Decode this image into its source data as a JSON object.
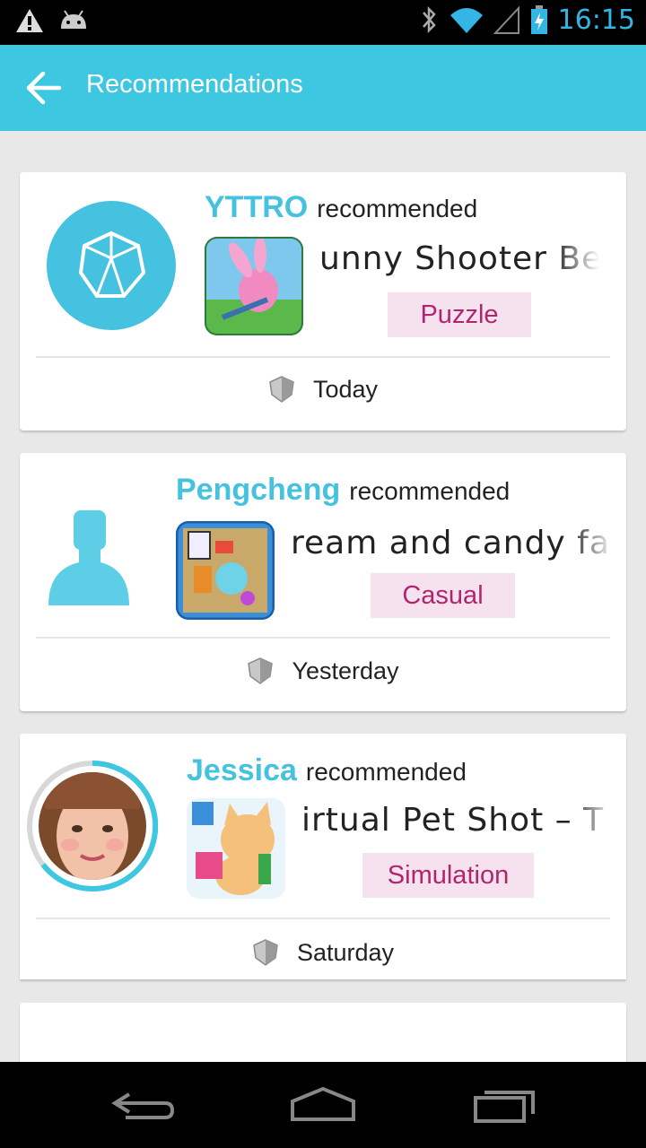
{
  "status": {
    "time": "16:15"
  },
  "header": {
    "title": "Recommendations"
  },
  "cards": [
    {
      "user": "YTTRO",
      "recommended": "recommended",
      "app": "unny Shooter Bes",
      "category": "Puzzle",
      "time": "Today"
    },
    {
      "user": "Pengcheng",
      "recommended": "recommended",
      "app": "ream and candy fa",
      "category": "Casual",
      "time": "Yesterday"
    },
    {
      "user": "Jessica",
      "recommended": "recommended",
      "app": "irtual Pet Shot – T",
      "category": "Simulation",
      "time": "Saturday"
    }
  ],
  "colors": {
    "accent": "#3dc7e0",
    "name": "#45c2df",
    "category_bg": "#f6e2ef",
    "category_text": "#b0266e"
  }
}
